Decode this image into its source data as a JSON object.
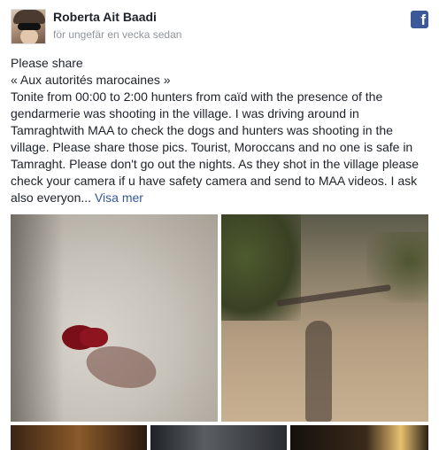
{
  "post": {
    "author": "Roberta Ait Baadi",
    "timestamp": "för ungefär en vecka sedan",
    "platform_icon": "facebook-icon",
    "text_lines": [
      "Please share",
      "« Aux autorités marocaines »",
      "Tonite from 00:00 to 2:00 hunters from caïd with the presence of the",
      "gendarmerie was shooting in the village. I was driving around in",
      "Tamraghtwith MAA to check the dogs and hunters was shooting in the",
      "village. Please share those pics. Tourist, Moroccans and no one is safe in",
      "Tamraght. Please don't go out the nights. As they shot in the village please",
      "check your camera if u have safety camera and send to MAA videos. I ask",
      "also everyon..."
    ],
    "see_more": "Visa mer"
  },
  "colors": {
    "facebook_blue": "#3b5998",
    "link": "#365899",
    "meta_text": "#90949c"
  }
}
